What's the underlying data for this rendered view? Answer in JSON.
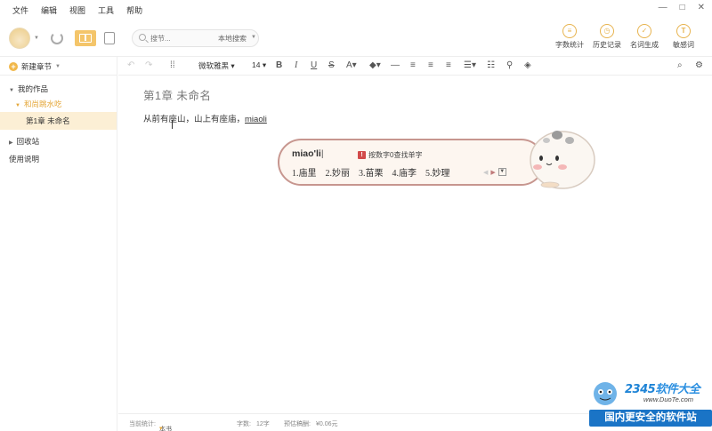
{
  "menu": [
    "文件",
    "编辑",
    "视图",
    "工具",
    "帮助"
  ],
  "search": {
    "placeholder": "搜节...",
    "scope": "本地搜索"
  },
  "tools": [
    {
      "icon": "word-count-icon",
      "label": "字数统计"
    },
    {
      "icon": "history-icon",
      "label": "历史记录"
    },
    {
      "icon": "name-generator-icon",
      "label": "名词生成"
    },
    {
      "icon": "sensitive-words-icon",
      "label": "敏感词"
    }
  ],
  "sidebar": {
    "new_chapter": "新建章节",
    "my_works": "我的作品",
    "volume": "和尚跳水吃",
    "chapter": "第1章 未命名",
    "recycle": "回收站",
    "help": "使用说明"
  },
  "format": {
    "font": "微软雅黑",
    "size": "14"
  },
  "editor": {
    "title": "第1章  未命名",
    "text": "从前有座山，山上有座庙，",
    "composition": "miaoli"
  },
  "ime": {
    "input": "miao'li",
    "hint": "按数字0查找单字",
    "candidates": [
      "1.庙里",
      "2.妙丽",
      "3.苗栗",
      "4.庙李",
      "5.妙理"
    ]
  },
  "status": {
    "count_label": "当前统计:",
    "count_scope": "本书",
    "words_label": "字数:",
    "words_value": "12字",
    "income_label": "预估稿酬:",
    "income_value": "¥0.06元"
  },
  "watermark": {
    "logo_num": "2345",
    "logo_text": "软件大全",
    "url": "www.DuoTe.com",
    "banner": "国内更安全的软件站"
  },
  "colors": {
    "accent": "#f1b84b",
    "ime_border": "#c7968f",
    "active_bg": "#fcefd5"
  }
}
